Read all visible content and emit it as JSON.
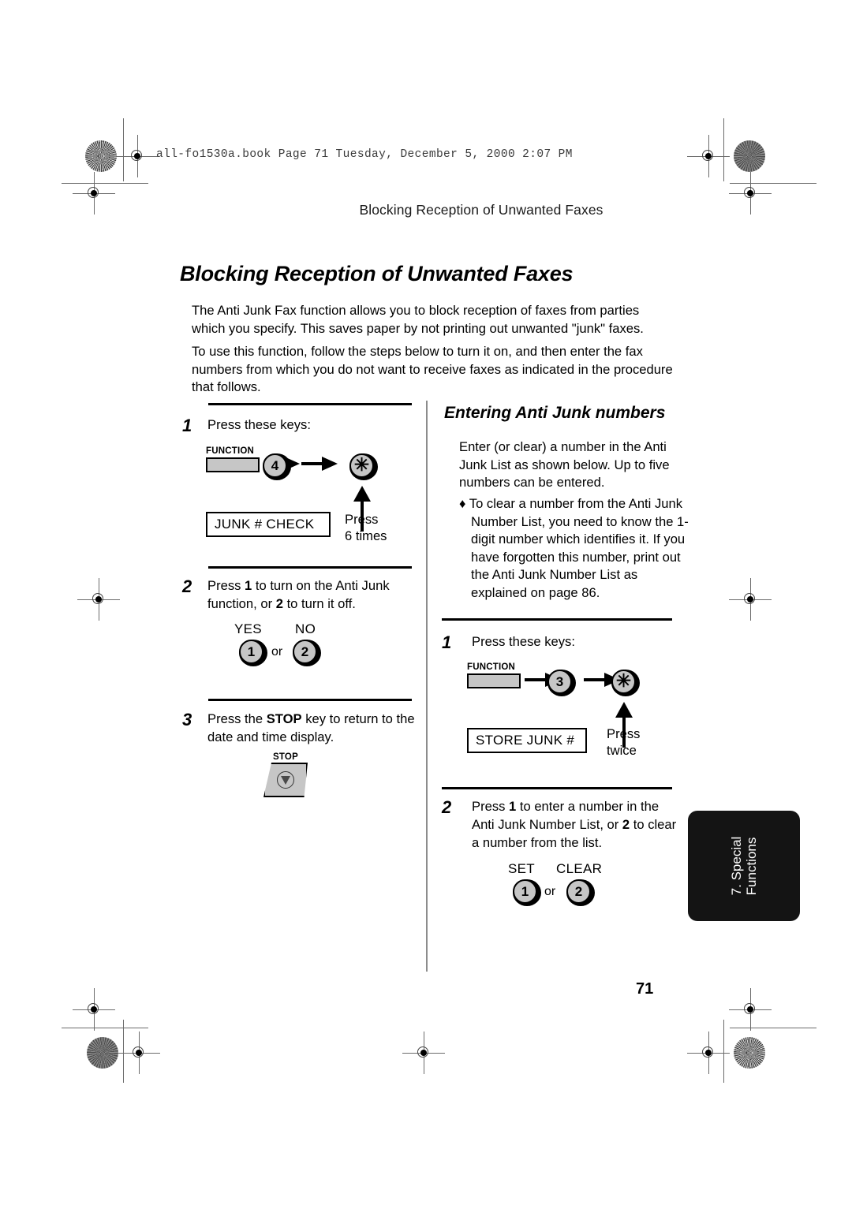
{
  "slug": "all-fo1530a.book  Page 71  Tuesday, December 5, 2000  2:07 PM",
  "running_header": "Blocking Reception of Unwanted Faxes",
  "page_title": "Blocking Reception of Unwanted Faxes",
  "page_number": "71",
  "intro": {
    "p1": "The Anti Junk Fax function allows you to block reception of faxes from parties which you specify. This saves paper by not printing out unwanted \"junk\" faxes.",
    "p2": "To use this function, follow the steps below to turn it on, and then enter the fax numbers from which you do not want to receive faxes as indicated in the procedure that follows."
  },
  "left_column": {
    "step1": {
      "num": "1",
      "text": "Press these keys:",
      "function_label": "FUNCTION",
      "key_digit": "4",
      "key_star": "✳",
      "lcd": "JUNK # CHECK",
      "note_line1": "Press",
      "note_line2": "6 times"
    },
    "step2": {
      "num": "2",
      "text_a": "Press ",
      "text_b": "1",
      "text_c": " to turn on the Anti Junk function, or ",
      "text_d": "2",
      "text_e": " to turn it off.",
      "label_yes": "YES",
      "label_no": "NO",
      "key_yes": "1",
      "key_no": "2",
      "or": "or"
    },
    "step3": {
      "num": "3",
      "text_a": "Press the ",
      "text_b": "STOP",
      "text_c": " key to return to the date and time display.",
      "stop_label": "STOP"
    }
  },
  "right_column": {
    "sub_title": "Entering Anti Junk numbers",
    "para": "Enter (or clear) a number in the Anti Junk List as shown below. Up to five numbers can be entered.",
    "bullet": "♦ To clear a number from the Anti Junk Number List, you need to know the 1-digit number which identifies it. If you have forgotten this number, print out the Anti Junk Number List as explained on page 86.",
    "step1": {
      "num": "1",
      "text": "Press these keys:",
      "function_label": "FUNCTION",
      "key_digit": "3",
      "key_star": "✳",
      "lcd": "STORE JUNK #",
      "note_line1": "Press",
      "note_line2": "twice"
    },
    "step2": {
      "num": "2",
      "text_a": "Press ",
      "text_b": "1",
      "text_c": " to enter a number in the Anti Junk Number List, or ",
      "text_d": "2",
      "text_e": " to clear a number from the list.",
      "label_set": "SET",
      "label_clear": "CLEAR",
      "key_set": "1",
      "key_clear": "2",
      "or": "or"
    }
  },
  "chapter_tab": {
    "line1": "7. Special",
    "line2": "Functions"
  },
  "colors": {
    "key_face": "#c6c6c6",
    "tab_background": "#141414",
    "divider": "#8c8c8c"
  }
}
